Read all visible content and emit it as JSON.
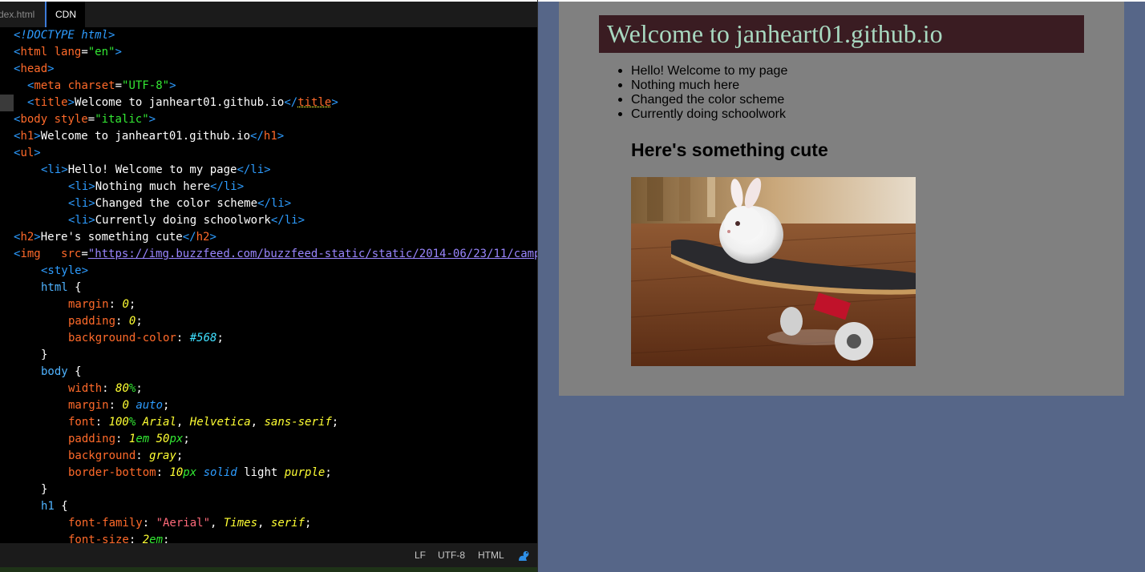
{
  "editor": {
    "tabs": [
      {
        "label": "dex.html",
        "active": false
      },
      {
        "label": "CDN",
        "active": true
      }
    ],
    "code": {
      "l1": "<!DOCTYPE html>",
      "l2": [
        "<",
        "html",
        " ",
        "lang",
        "=",
        "\"en\"",
        ">"
      ],
      "l3": [
        "<",
        "head",
        ">"
      ],
      "l4": [
        "<",
        "meta",
        " ",
        "charset",
        "=",
        "\"UTF-8\"",
        ">"
      ],
      "l5": [
        "<",
        "title",
        ">",
        "Welcome to janheart01.github.io",
        "</",
        "title",
        ">"
      ],
      "l6": [
        "<",
        "body",
        " ",
        "style",
        "=",
        "\"italic\"",
        ">"
      ],
      "l7": [
        "<",
        "h1",
        ">",
        "Welcome to janheart01.github.io",
        "</",
        "h1",
        ">"
      ],
      "l8": [
        "<",
        "ul",
        ">"
      ],
      "l9": [
        "<li>",
        "Hello! Welcome to my page",
        "</li>"
      ],
      "l10": [
        "<li>",
        "Nothing much here",
        "</li>"
      ],
      "l11": [
        "<li>",
        "Changed the color scheme",
        "</li>"
      ],
      "l12": [
        "<li>",
        "Currently doing schoolwork",
        "</li>"
      ],
      "l13": [
        "<",
        "h2",
        ">",
        "Here's something cute",
        "</",
        "h2",
        ">"
      ],
      "l14": [
        "<",
        "img",
        "   ",
        "src",
        "=",
        "\"https://img.buzzfeed.com/buzzfeed-static/static/2014-06/23/11/camp"
      ],
      "l15": [
        "<style>"
      ],
      "l16": [
        "html",
        " {"
      ],
      "l17": [
        "margin",
        ": ",
        "0",
        ";"
      ],
      "l18": [
        "padding",
        ": ",
        "0",
        ";"
      ],
      "l19": [
        "background-color",
        ": ",
        "#568",
        ";"
      ],
      "l20": [
        "}"
      ],
      "l21": [
        "body",
        " {"
      ],
      "l22": [
        "width",
        ": ",
        "80",
        "%",
        ";"
      ],
      "l23": [
        "margin",
        ": ",
        "0",
        " ",
        "auto",
        ";"
      ],
      "l24": [
        "font",
        ": ",
        "100",
        "%",
        " ",
        "Arial",
        ", ",
        "Helvetica",
        ", ",
        "sans-serif",
        ";"
      ],
      "l25": [
        "padding",
        ": ",
        "1",
        "em",
        " ",
        "50",
        "px",
        ";"
      ],
      "l26": [
        "background",
        ": ",
        "gray",
        ";"
      ],
      "l27": [
        "border-bottom",
        ": ",
        "10",
        "px",
        " ",
        "solid",
        " light ",
        "purple",
        ";"
      ],
      "l28": [
        "}"
      ],
      "l29": [
        "h1",
        " {"
      ],
      "l30": [
        "font-family",
        ": ",
        "\"Aerial\"",
        ", ",
        "Times",
        ", ",
        "serif",
        ";"
      ],
      "l31": [
        "font-size",
        ": ",
        "2",
        "em",
        ";"
      ]
    }
  },
  "statusbar": {
    "line_ending": "LF",
    "encoding": "UTF-8",
    "grammar": "HTML",
    "icon": "squirrel-icon"
  },
  "preview": {
    "h1": "Welcome to janheart01.github.io",
    "list": [
      "Hello! Welcome to my page",
      "Nothing much here",
      "Changed the color scheme",
      "Currently doing schoolwork"
    ],
    "h2": "Here's something cute",
    "image": "bunny-on-skateboard-image"
  },
  "colors": {
    "preview_page_bg": "#566688",
    "preview_body_bg": "#808080",
    "preview_h1_bg": "#3a1c22",
    "preview_h1_text": "#a8d8c0",
    "editor_bg": "#000000"
  }
}
